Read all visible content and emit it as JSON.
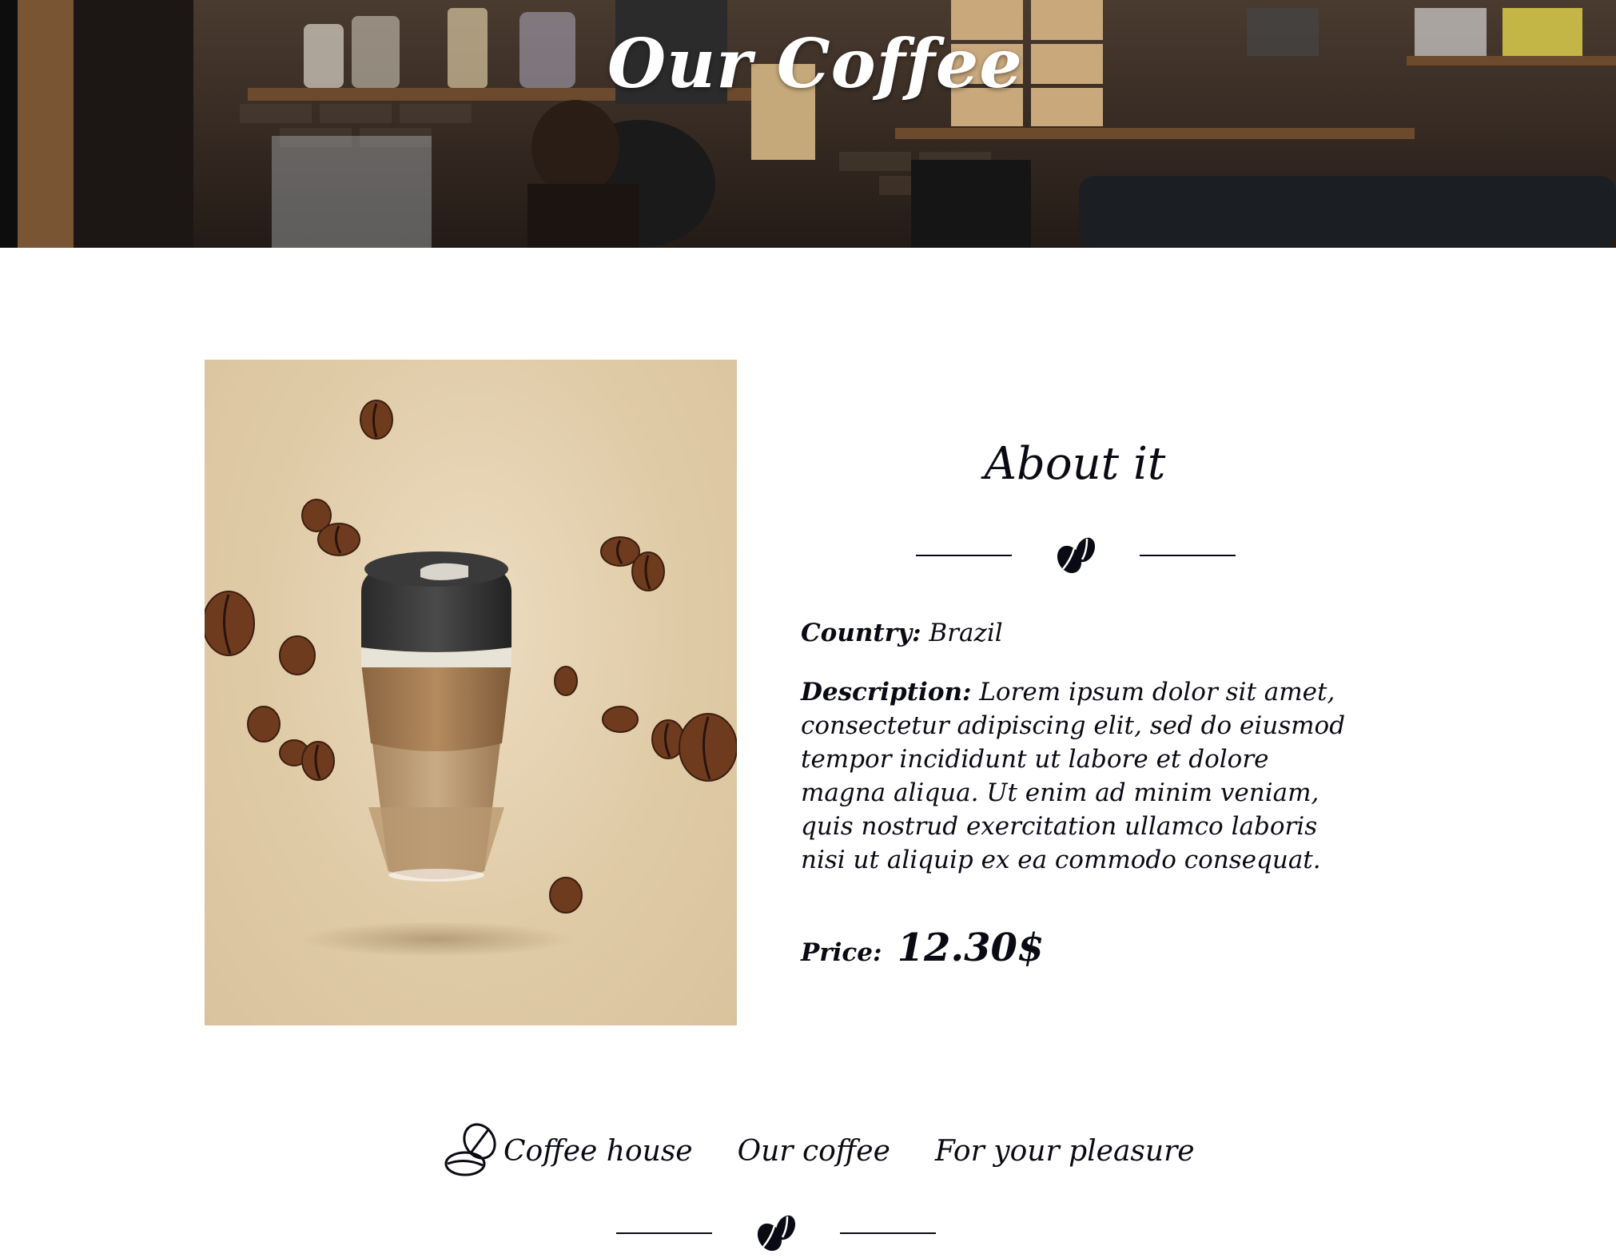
{
  "header": {
    "title": "Our Coffee"
  },
  "product": {
    "image_alt": "coffee-cup-with-flying-beans"
  },
  "about": {
    "title": "About it",
    "country_label": "Country:",
    "country_value": "Brazil",
    "description_label": "Description:",
    "description_value": "Lorem ipsum dolor sit amet, consectetur adipiscing elit, sed do eiusmod tempor incididunt ut labore et dolore magna aliqua. Ut enim ad minim veniam, quis nostrud exercitation ullamco laboris nisi ut aliquip ex ea commodo consequat.",
    "price_label": "Price:",
    "price_value": "12.30$"
  },
  "footer": {
    "nav": [
      {
        "label": "Coffee house"
      },
      {
        "label": "Our coffee"
      },
      {
        "label": "For your pleasure"
      }
    ]
  },
  "icons": {
    "divider": "coffee-beans-icon",
    "logo": "coffee-beans-outline-icon"
  },
  "colors": {
    "text": "#0a0a14",
    "background": "#ffffff",
    "banner_title": "#ffffff",
    "product_bg": "#e0cba7"
  }
}
